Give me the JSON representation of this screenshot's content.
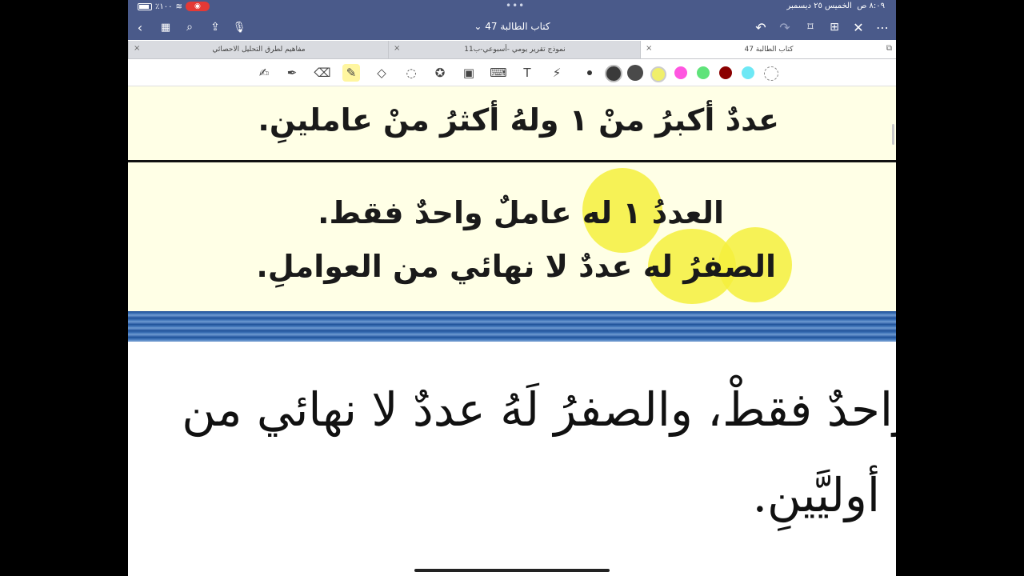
{
  "status": {
    "time": "٨:٠٩ ص",
    "date": "الخميس ٢٥ ديسمبر",
    "battery": "٪١٠٠"
  },
  "nav": {
    "title": "كتاب الطالبة 47",
    "title_chevron": "⌄"
  },
  "tabs": [
    {
      "label": "كتاب الطالبة 47",
      "active": true
    },
    {
      "label": "نموذج تقرير يومي -أسبوعي-ب11",
      "active": false
    },
    {
      "label": "مفاهيم لطرق التحليل الاحصائي",
      "active": false
    }
  ],
  "swatches": [
    "#333333",
    "#3a3a3a",
    "#4a4a4a",
    "#f0ef6a",
    "#ff55e0",
    "#5fe37a",
    "#8b0000",
    "#6ee8f5"
  ],
  "content": {
    "line1": "عددٌ أكبرُ منْ ١ ولهُ أكثرُ منْ عاملينِ.",
    "line2": "العددُ ١ له عاملٌ واحدٌ فقط.",
    "line3": "الصفرُ له عددٌ لا نهائي من العواملِ.",
    "big1": "واحدٌ فقطْ، والصفرُ لَهُ عددٌ لا نهائي من",
    "big2": "أوليَّينِ."
  }
}
